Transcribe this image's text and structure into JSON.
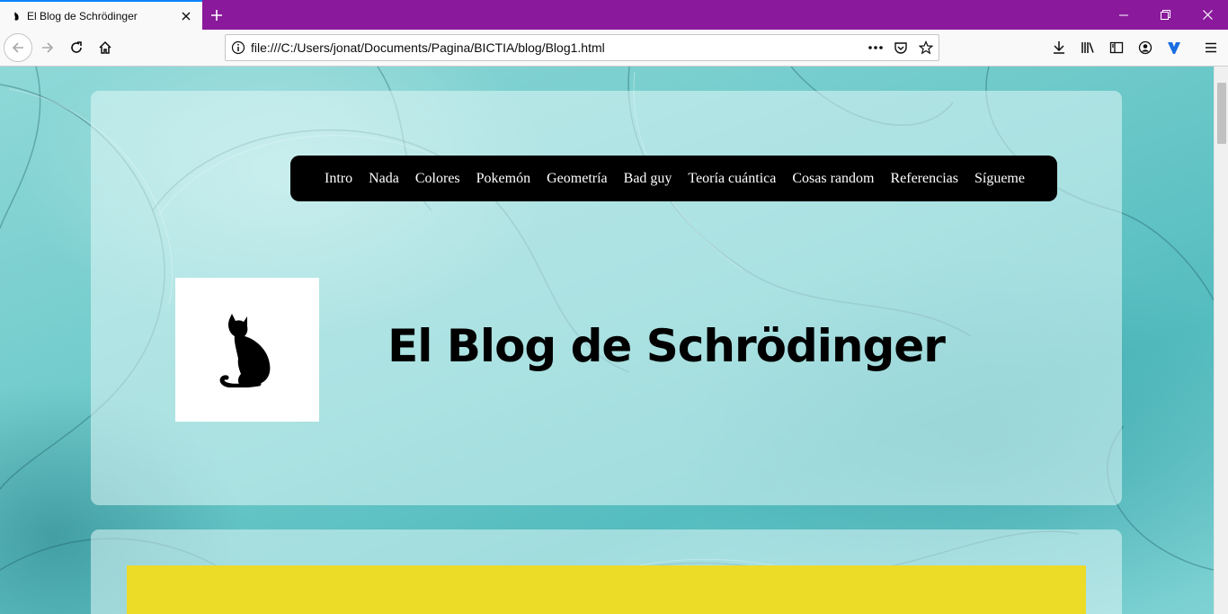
{
  "browser": {
    "tab_title": "El Blog de Schrödinger",
    "url": "file:///C:/Users/jonat/Documents/Pagina/BICTIA/blog/Blog1.html",
    "accent_color": "#8a1a9b"
  },
  "page": {
    "menu": [
      {
        "label": "Intro"
      },
      {
        "label": "Nada"
      },
      {
        "label": "Colores"
      },
      {
        "label": "Pokemón"
      },
      {
        "label": "Geometría"
      },
      {
        "label": "Bad guy"
      },
      {
        "label": "Teoría cuántica"
      },
      {
        "label": "Cosas random"
      },
      {
        "label": "Referencias"
      },
      {
        "label": "Sígueme"
      }
    ],
    "logo_icon": "cat-silhouette-icon",
    "title": "El Blog de Schrödinger",
    "highlight_color": "#ecdb27"
  }
}
